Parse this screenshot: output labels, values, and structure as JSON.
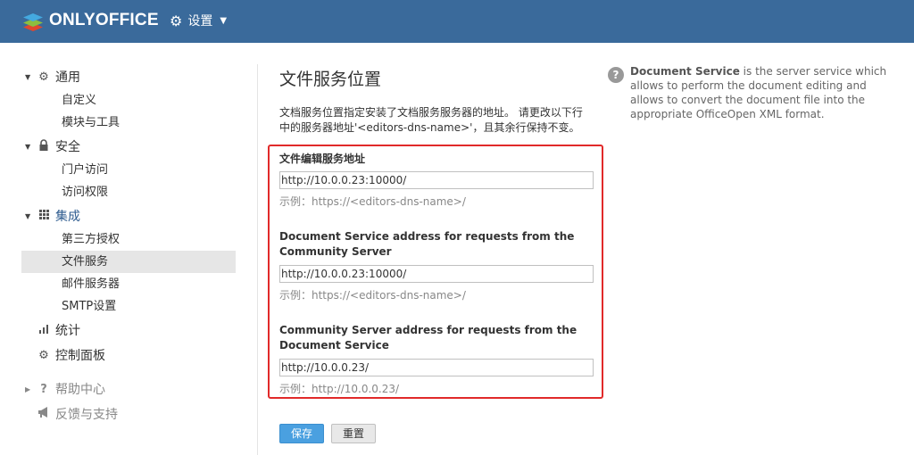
{
  "header": {
    "app_name": "ONLYOFFICE",
    "settings_label": "设置",
    "brand_color": "#3a6a9b"
  },
  "sidebar": {
    "sections": [
      {
        "label": "通用",
        "icon": "gear-icon",
        "items": [
          "自定义",
          "模块与工具"
        ]
      },
      {
        "label": "安全",
        "icon": "lock-icon",
        "items": [
          "门户访问",
          "访问权限"
        ]
      },
      {
        "label": "集成",
        "icon": "grid-icon",
        "items": [
          "第三方授权",
          "文件服务",
          "邮件服务器",
          "SMTP设置"
        ],
        "selected": "文件服务"
      },
      {
        "label": "统计",
        "icon": "bar-chart-icon"
      },
      {
        "label": "控制面板",
        "icon": "control-panel-icon"
      },
      {
        "label": "帮助中心",
        "icon": "question-icon"
      },
      {
        "label": "反馈与支持",
        "icon": "megaphone-icon"
      }
    ]
  },
  "main": {
    "title": "文件服务位置",
    "description": "文档服务位置指定安装了文档服务服务器的地址。 请更改以下行中的服务器地址'<editors-dns-name>'，且其余行保持不变。",
    "fields": [
      {
        "label": "文件编辑服务地址",
        "value": "http://10.0.0.23:10000/",
        "hint": "示例：https://<editors-dns-name>/"
      },
      {
        "label": "Document Service address for requests from the Community Server",
        "value": "http://10.0.0.23:10000/",
        "hint": "示例：https://<editors-dns-name>/"
      },
      {
        "label": "Community Server address for requests from the Document Service",
        "value": "http://10.0.0.23/",
        "hint": "示例：http://10.0.0.23/"
      }
    ],
    "save_label": "保存",
    "reset_label": "重置",
    "highlight_color": "#e12a2a"
  },
  "help": {
    "title": "Document Service",
    "text": " is the server service which allows to perform the document editing and allows to convert the document file into the appropriate OfficeOpen XML format."
  }
}
